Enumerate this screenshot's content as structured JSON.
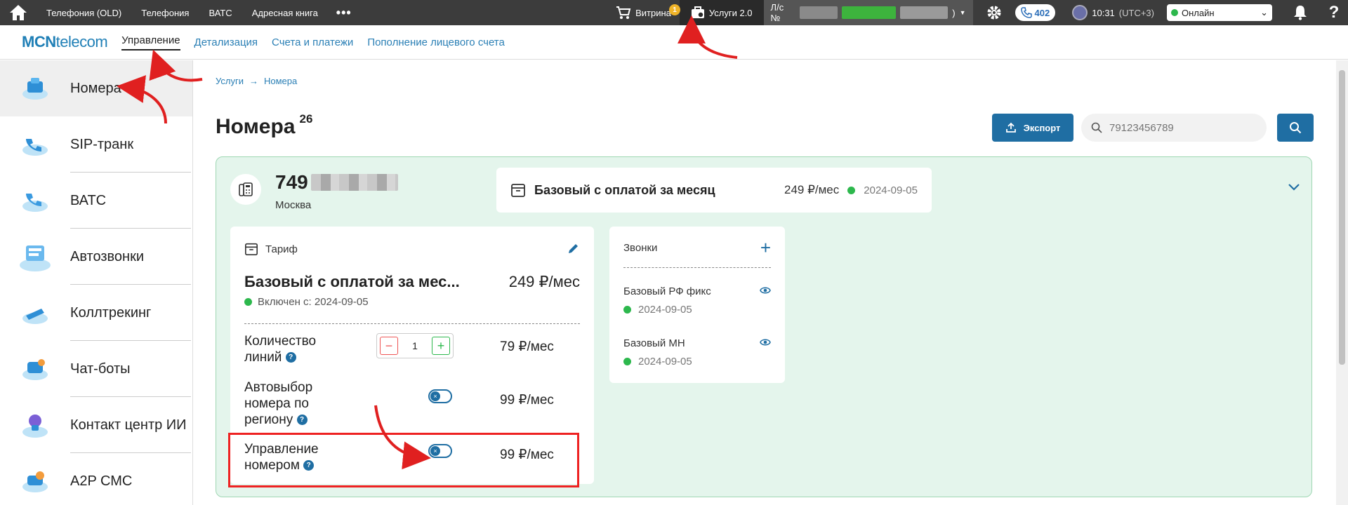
{
  "topbar": {
    "nav": [
      "Телефония (OLD)",
      "Телефония",
      "ВАТС",
      "Адресная книга"
    ],
    "more": "•••",
    "vitrina_label": "Витрина",
    "vitrina_badge": "1",
    "services_label": "Услуги 2.0",
    "account_prefix": "Л/с №",
    "account_suffix": ")",
    "phone_count": "402",
    "time": "10:31",
    "timezone": "(UTC+3)",
    "status": "Онлайн",
    "help": "?"
  },
  "subnav": {
    "logo_bold": "MCN",
    "logo_thin": "telecom",
    "tabs": [
      "Управление",
      "Детализация",
      "Счета и платежи",
      "Пополнение лицевого счета"
    ]
  },
  "sidebar": {
    "items": [
      "Номера",
      "SIP-транк",
      "ВАТС",
      "Автозвонки",
      "Коллтрекинг",
      "Чат-боты",
      "Контакт центр ИИ",
      "A2P СМС"
    ]
  },
  "breadcrumb": {
    "root": "Услуги",
    "current": "Номера"
  },
  "page": {
    "title": "Номера",
    "count": "26"
  },
  "toolbar": {
    "export_label": "Экспорт",
    "search_placeholder": "79123456789"
  },
  "number_card": {
    "number_prefix": "749",
    "city": "Москва",
    "tariff_name": "Базовый с оплатой за месяц",
    "tariff_price": "249 ₽/мес",
    "tariff_date": "2024-09-05"
  },
  "tariff_panel": {
    "header": "Тариф",
    "name": "Базовый с оплатой за мес...",
    "price": "249 ₽/мес",
    "since": "Включен с: 2024-09-05",
    "options": [
      {
        "label": "Количество линий",
        "price": "79 ₽/мес",
        "quantity": "1"
      },
      {
        "label": "Автовыбор номера по региону",
        "price": "99 ₽/мес"
      },
      {
        "label": "Управление номером",
        "price": "99 ₽/мес"
      }
    ]
  },
  "calls_panel": {
    "header": "Звонки",
    "items": [
      {
        "name": "Базовый РФ фикс",
        "date": "2024-09-05"
      },
      {
        "name": "Базовый МН",
        "date": "2024-09-05"
      }
    ]
  },
  "colors": {
    "accent": "#1f6ea3",
    "active_green": "#2db84d",
    "card_bg": "#e4f5ec",
    "highlight_red": "#e22"
  }
}
